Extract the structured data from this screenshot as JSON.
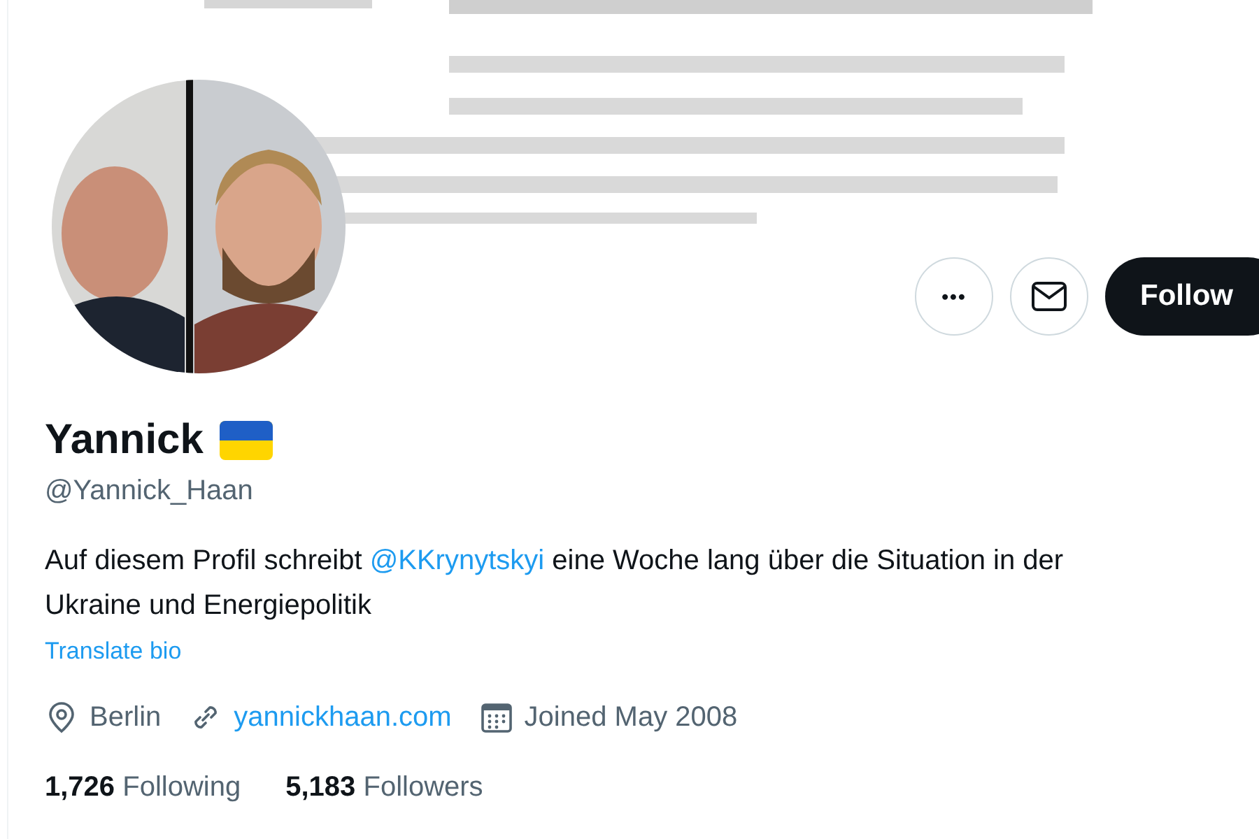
{
  "actions": {
    "more": "•••",
    "follow": "Follow"
  },
  "profile": {
    "name": "Yannick",
    "handle": "@Yannick_Haan",
    "bio": [
      {
        "kind": "text",
        "text": "Auf diesem Profil schreibt "
      },
      {
        "kind": "mention",
        "text": "@KKrynytskyi"
      },
      {
        "kind": "text",
        "text": " eine Woche lang über die Situation in der Ukraine und Energiepolitik"
      }
    ],
    "translate": "Translate bio",
    "meta": [
      {
        "kind": "location",
        "text": "Berlin"
      },
      {
        "kind": "link",
        "text": "yannickhaan.com"
      },
      {
        "kind": "joined",
        "text": "Joined May 2008"
      }
    ],
    "stats": [
      {
        "count": "1,726",
        "label": "Following"
      },
      {
        "count": "5,183",
        "label": "Followers"
      }
    ]
  }
}
